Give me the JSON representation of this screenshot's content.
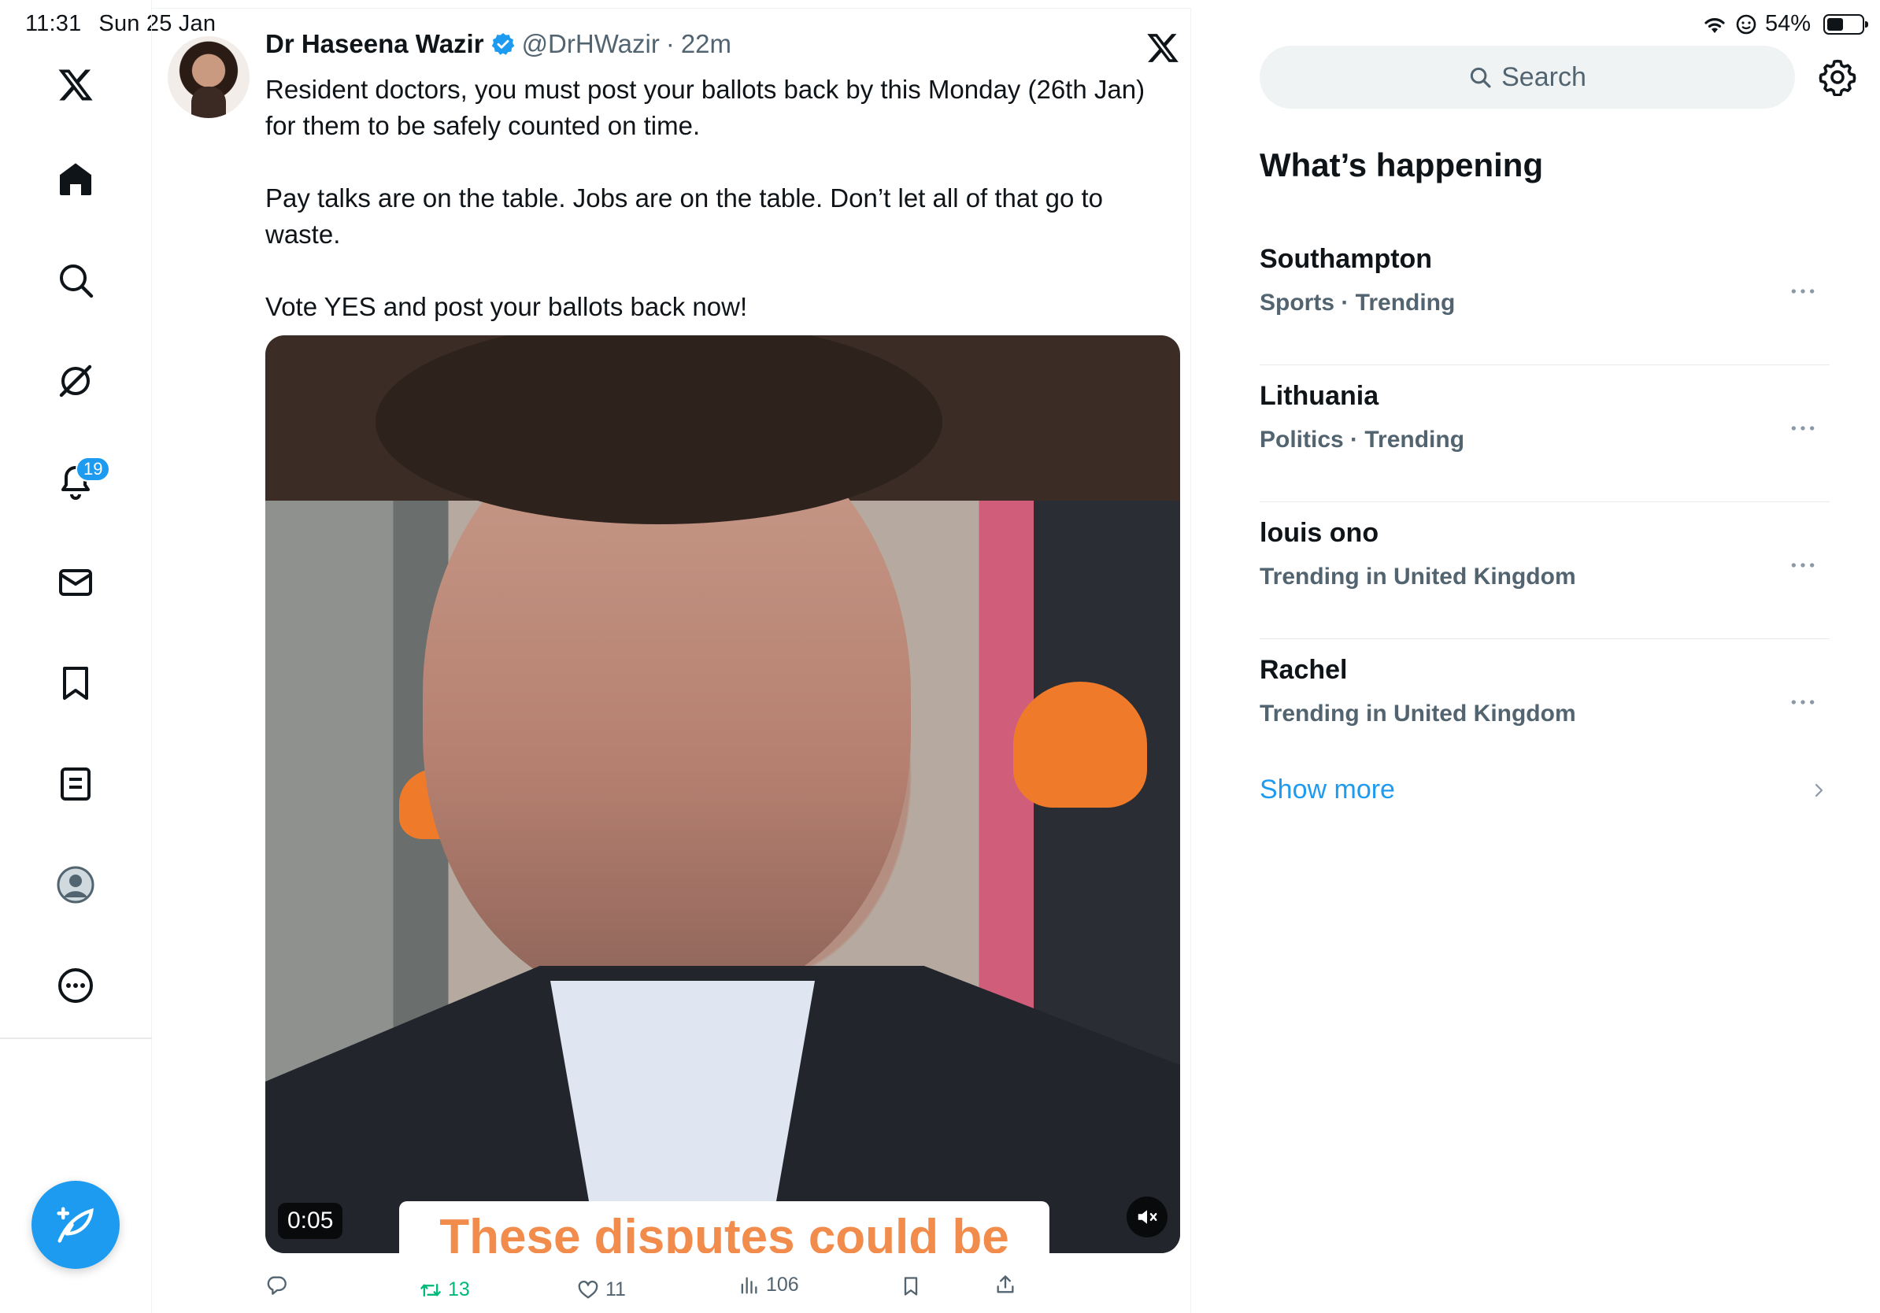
{
  "status_bar": {
    "time": "11:31",
    "date": "Sun 25 Jan",
    "battery": "54%",
    "battery_level": 0.54
  },
  "nav": {
    "notifications_badge": "19"
  },
  "tweet": {
    "name": "Dr Haseena Wazir",
    "handle": "@DrHWazir",
    "separator": "·",
    "time": "22m",
    "paragraphs": [
      "Resident doctors, you must post your ballots back by this Monday (26th Jan) for them to be safely counted on time.",
      "Pay talks are on the table. Jobs are on the table. Don’t let all of that go to waste.",
      "Vote YES and post your ballots back now!"
    ],
    "video": {
      "timestamp": "0:05",
      "caption": "These disputes could be"
    },
    "actions": {
      "replies": "",
      "retweets": "13",
      "likes": "11",
      "views": "106"
    }
  },
  "sidebar": {
    "search_placeholder": "Search",
    "title": "What’s happening",
    "trends": [
      {
        "name": "Southampton",
        "meta": "Sports · Trending"
      },
      {
        "name": "Lithuania",
        "meta": "Politics · Trending"
      },
      {
        "name": "louis ono",
        "meta": "Trending in United Kingdom"
      },
      {
        "name": "Rachel",
        "meta": "Trending in United Kingdom"
      }
    ],
    "show_more": "Show more"
  },
  "colors": {
    "accent": "#1d9bf0",
    "retweet": "#00ba7c",
    "secondary_text": "#536471"
  }
}
